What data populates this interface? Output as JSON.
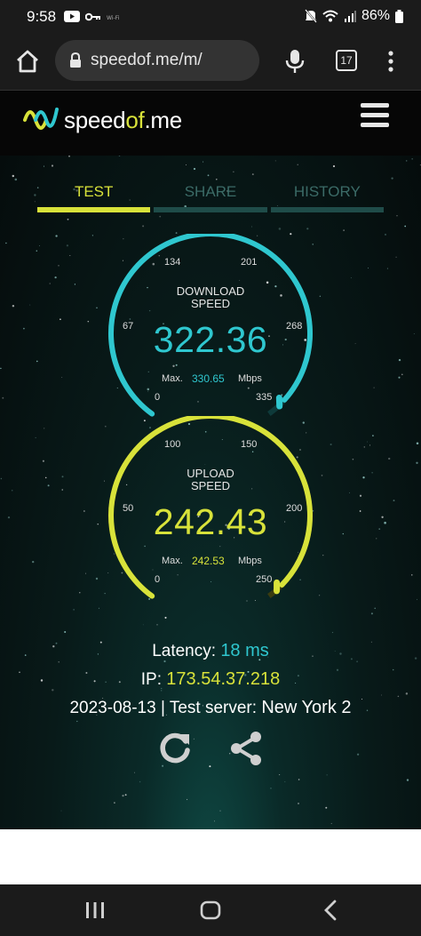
{
  "status_bar": {
    "time": "9:58",
    "icons_left": [
      "youtube-icon",
      "key-icon",
      "wifi-calling-icon"
    ],
    "icons_right": [
      "mute-icon",
      "wifi-icon",
      "signal-icon",
      "battery-icon"
    ],
    "battery": "86%"
  },
  "browser": {
    "url": "speedof.me/m/",
    "tab_count": "17"
  },
  "site": {
    "logo_part1": "speed",
    "logo_part2": "of",
    "logo_part3": ".me",
    "tabs": [
      {
        "label": "TEST",
        "active": true
      },
      {
        "label": "SHARE",
        "active": false
      },
      {
        "label": "HISTORY",
        "active": false
      }
    ]
  },
  "download": {
    "title_line1": "DOWNLOAD",
    "title_line2": "SPEED",
    "value": "322.36",
    "max_label": "Max.",
    "max_value": "330.65",
    "unit": "Mbps",
    "ticks": [
      "0",
      "67",
      "134",
      "201",
      "268",
      "335"
    ],
    "scale_max": 335,
    "reading": 322.36,
    "color": "#2fc7cf"
  },
  "upload": {
    "title_line1": "UPLOAD",
    "title_line2": "SPEED",
    "value": "242.43",
    "max_label": "Max.",
    "max_value": "242.53",
    "unit": "Mbps",
    "ticks": [
      "0",
      "50",
      "100",
      "150",
      "200",
      "250"
    ],
    "scale_max": 250,
    "reading": 242.43,
    "color": "#d8e23a"
  },
  "results": {
    "latency_label": "Latency:",
    "latency_value": "18 ms",
    "ip_label": "IP:",
    "ip_value": "173.54.37.218",
    "date": "2023-08-13",
    "separator": "|",
    "server_label": "Test server:",
    "server_value": "New York 2"
  }
}
